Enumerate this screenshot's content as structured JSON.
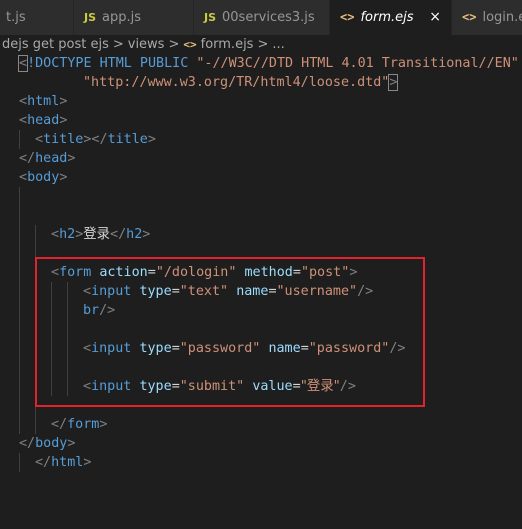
{
  "tabs": [
    {
      "icon": "",
      "label": "t.js"
    },
    {
      "icon": "JS",
      "label": "app.js"
    },
    {
      "icon": "JS",
      "label": "00services3.js"
    },
    {
      "icon": "<>",
      "label": "form.ejs",
      "close": "×"
    },
    {
      "icon": "<>",
      "label": "login.ejs"
    }
  ],
  "breadcrumb": {
    "segments": [
      "dejs get post ejs",
      "views",
      "form.ejs",
      "..."
    ],
    "separator": ">",
    "file_icon": "<>"
  },
  "code": {
    "l1": {
      "open": "<",
      "doctype": "!DOCTYPE HTML PUBLIC",
      "str": "\"-//W3C//DTD HTML 4.01 Transitional//EN\""
    },
    "l2": {
      "str": "\"http://www.w3.org/TR/html4/loose.dtd\"",
      "close": ">"
    },
    "html": "html",
    "head": "head",
    "title": "title",
    "body": "body",
    "h2": "h2",
    "h2_text": "登录",
    "form": "form",
    "action_attr": "action",
    "action_val": "\"/dologin\"",
    "method_attr": "method",
    "method_val": "\"post\"",
    "input": "input",
    "type_attr": "type",
    "name_attr": "name",
    "value_attr": "value",
    "text_val": "\"text\"",
    "username_val": "\"username\"",
    "br": "br",
    "password_val": "\"password\"",
    "submit_val": "\"submit\"",
    "login_val": "\"登录\""
  },
  "colors": {
    "tag": "#569cd6",
    "attribute": "#9cdcfe",
    "string": "#ce9178",
    "highlight_box": "#e0232c"
  }
}
